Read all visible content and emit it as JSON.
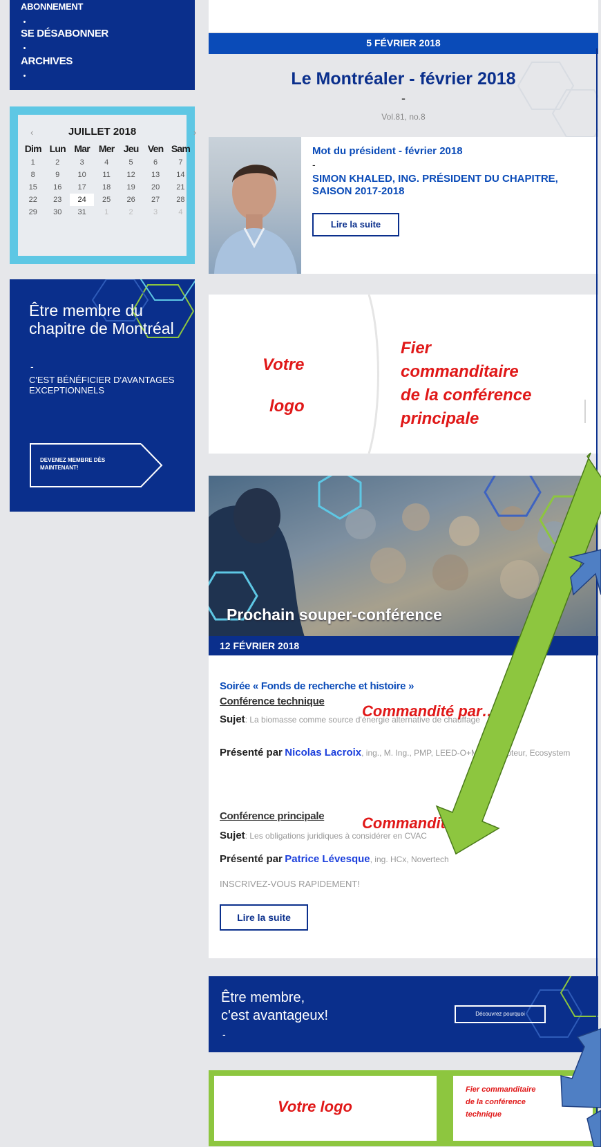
{
  "nav": {
    "items": [
      {
        "label": "ABONNEMENT"
      },
      {
        "label": "SE DÉSABONNER"
      },
      {
        "label": "ARCHIVES"
      }
    ]
  },
  "calendar": {
    "title": "JUILLET 2018",
    "prev": "‹",
    "next": "›",
    "weekdays": [
      "Dim",
      "Lun",
      "Mar",
      "Mer",
      "Jeu",
      "Ven",
      "Sam"
    ],
    "weeks": [
      [
        "1",
        "2",
        "3",
        "4",
        "5",
        "6",
        "7"
      ],
      [
        "8",
        "9",
        "10",
        "11",
        "12",
        "13",
        "14"
      ],
      [
        "15",
        "16",
        "17",
        "18",
        "19",
        "20",
        "21"
      ],
      [
        "22",
        "23",
        "24",
        "25",
        "26",
        "27",
        "28"
      ],
      [
        "29",
        "30",
        "31",
        "1",
        "2",
        "3",
        "4"
      ]
    ],
    "today": "24"
  },
  "promo": {
    "title": "Être membre du chapitre de Montréal",
    "dash": "-",
    "subtitle": "C'EST BÉNÉFICIER D'AVANTAGES EXCEPTIONNELS",
    "button": "DEVENEZ MEMBRE DÈS MAINTENANT!"
  },
  "issue": {
    "date": "5 FÉVRIER 2018",
    "headline": "Le Montréaler - février 2018",
    "dash": "-",
    "volume": "Vol.81, no.8"
  },
  "president": {
    "title": "Mot du président - février 2018",
    "dash": "-",
    "subtitle": "SIMON KHALED, ING. PRÉSIDENT DU CHAPITRE, SAISON 2017-2018",
    "read_more": "Lire la suite"
  },
  "sponsor_main": {
    "logo_line1": "Votre",
    "logo_line2": "logo",
    "text_line1": "Fier",
    "text_line2": "commanditaire",
    "text_line3": "de la conférence",
    "text_line4": "principale"
  },
  "event": {
    "title": "Prochain souper-conférence",
    "date": "12 FÉVRIER 2018",
    "series": "Soirée « Fonds de recherche et histoire »",
    "tech_heading": "Conférence technique",
    "tech_sponsor": "Commandité par…",
    "tech_subject_label": "Sujet",
    "tech_subject": ": La biomasse comme source d'énergie alternative de chauffage",
    "tech_presenter_label": "Présenté par",
    "tech_presenter_name": "Nicolas Lacroix",
    "tech_presenter_rest": ", ing., M. Ing., PMP, LEED-O+M, Concepteur, Ecosystem",
    "main_heading": "Conférence principale",
    "main_sponsor": "Commandité par…",
    "main_subject_label": "Sujet",
    "main_subject": ": Les obligations juridiques à considérer en CVAC",
    "main_presenter_label": "Présenté par",
    "main_presenter_name": "Patrice Lévesque",
    "main_presenter_rest": ", ing. HCx, Novertech",
    "register": "INSCRIVEZ-VOUS RAPIDEMENT!",
    "read_more": "Lire la suite"
  },
  "promo2": {
    "line1": "Être membre,",
    "line2": "c'est avantageux!",
    "dash": "-",
    "button": "Découvrez pourquoi"
  },
  "sponsor_tech": {
    "logo": "Votre logo",
    "text_line1": "Fier commanditaire",
    "text_line2": "de la conférence",
    "text_line3": "technique"
  },
  "colors": {
    "navy": "#0a2f8c",
    "blue": "#0a4bb8",
    "cyan": "#5ec7e4",
    "green": "#8dc63f",
    "red": "#e01818",
    "arrow_blue": "#4f7fc4"
  }
}
